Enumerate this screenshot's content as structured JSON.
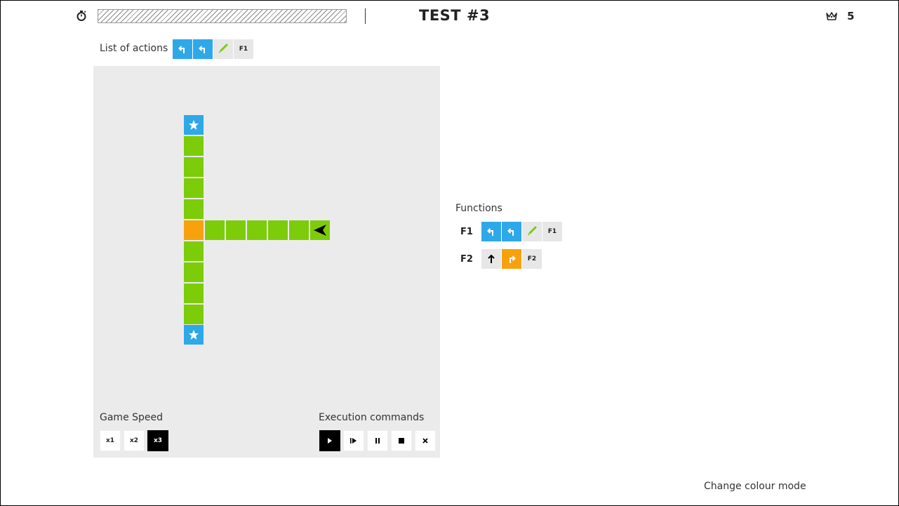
{
  "header": {
    "title": "TEST #3",
    "score": "5",
    "timer_icon": "stopwatch-icon",
    "score_icon": "crown-icon"
  },
  "actions": {
    "label": "List of actions",
    "items": [
      {
        "icon": "turn-left-icon",
        "color": "#2ea8e8"
      },
      {
        "icon": "turn-left-icon",
        "color": "#2ea8e8"
      },
      {
        "icon": "paint-brush-icon",
        "color": "#e7e7e7"
      },
      {
        "label": "F1",
        "color": "#e7e7e7"
      }
    ]
  },
  "board": {
    "background": "#ebebeb",
    "tile_colors": {
      "green": "#7ccc0a",
      "orange": "#f7a10d",
      "star": "#2ea8e8"
    },
    "robot": "arrow-left"
  },
  "game_speed": {
    "label": "Game Speed",
    "options": [
      "x1",
      "x2",
      "x3"
    ],
    "selected": "x3"
  },
  "execution": {
    "label": "Execution commands",
    "buttons": [
      {
        "icon": "play-icon",
        "active": true
      },
      {
        "icon": "step-icon"
      },
      {
        "icon": "pause-icon"
      },
      {
        "icon": "stop-icon"
      },
      {
        "icon": "close-icon"
      }
    ]
  },
  "functions": {
    "label": "Functions",
    "f1": {
      "name": "F1",
      "items": [
        {
          "icon": "turn-left-icon",
          "color": "#2ea8e8"
        },
        {
          "icon": "turn-left-icon",
          "color": "#2ea8e8"
        },
        {
          "icon": "paint-brush-icon",
          "color": "#e7e7e7"
        },
        {
          "label": "F1",
          "color": "#e7e7e7"
        }
      ]
    },
    "f2": {
      "name": "F2",
      "items": [
        {
          "icon": "arrow-up-icon",
          "color": "#e7e7e7"
        },
        {
          "icon": "turn-right-icon",
          "color": "#f7a10d"
        },
        {
          "label": "F2",
          "color": "#e7e7e7"
        }
      ]
    }
  },
  "footer": {
    "colour_mode": "Change colour mode"
  }
}
